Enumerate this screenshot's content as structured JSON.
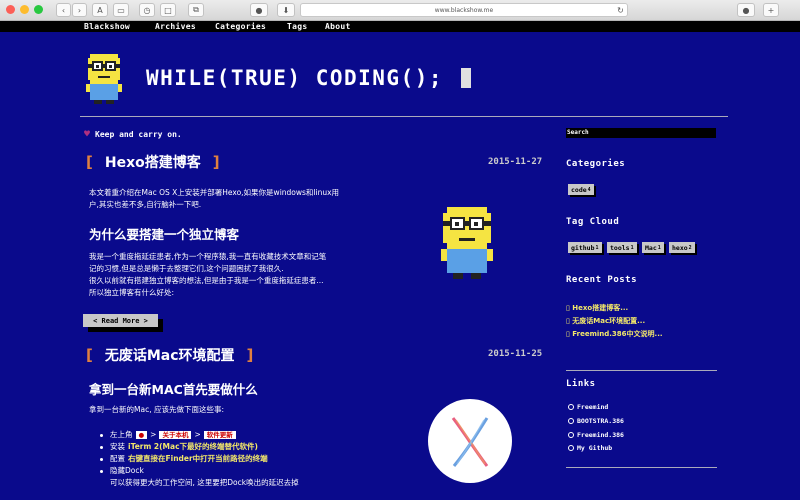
{
  "browser": {
    "url": "www.blackshow.me",
    "colors": {
      "close": "#fc5f57",
      "min": "#fdbc2e",
      "max": "#28c840"
    }
  },
  "nav": {
    "items": [
      {
        "label": "Blackshow"
      },
      {
        "label": "Archives"
      },
      {
        "label": "Categories"
      },
      {
        "label": "Tags"
      },
      {
        "label": "About"
      }
    ]
  },
  "header": {
    "title": "WHILE(TRUE) CODING();",
    "tagline": "Keep and carry on."
  },
  "posts": [
    {
      "title": "Hexo搭建博客",
      "date": "2015-11-27",
      "intro_line1": "本文着重介绍在Mac OS X上安装并部署Hexo,如果你是windows和linux用",
      "intro_line2": "户,其实也差不多,自行脑补一下吧.",
      "subheading": "为什么要搭建一个独立博客",
      "body_line1": "我是一个重度拖延症患者,作为一个程序猿,我一直有收藏技术文章和记笔",
      "body_line2": "记的习惯,但是总是懒于去整理它们,这个问题困扰了我很久.",
      "body_line3": "很久以前就有搭建独立博客的想法,但是由于我是一个重度拖延症患者...",
      "body_line4": "所以独立博客有什么好处:",
      "read_more": "< Read More >"
    },
    {
      "title": "无废话Mac环境配置",
      "date": "2015-11-25",
      "subheading": "拿到一台新MAC首先要做什么",
      "intro": "拿到一台新的Mac, 应该先做下面这些事:",
      "bullet1_pre": "左上角",
      "bullet1_key1": "",
      "bullet1_key2": "关于本机",
      "bullet1_key3": "软件更新",
      "bullet2_pre": "安装",
      "bullet2_hl": "iTerm 2(Mac下最好的终端替代软件)",
      "bullet3_pre": "配置",
      "bullet3_hl": "右键直接在Finder中打开当前路径的终端",
      "bullet4": "隐藏Dock",
      "bullet4_sub": "可以获得更大的工作空间, 这里要把Dock唤出的延迟去掉"
    }
  ],
  "sidebar": {
    "search_placeholder": "Search",
    "categories_heading": "Categories",
    "categories": [
      {
        "name": "code",
        "count": "4"
      }
    ],
    "tagcloud_heading": "Tag Cloud",
    "tags": [
      {
        "name": "github",
        "count": "1"
      },
      {
        "name": "tools",
        "count": "1"
      },
      {
        "name": "Mac",
        "count": "1"
      },
      {
        "name": "hexo",
        "count": "2"
      }
    ],
    "recent_heading": "Recent Posts",
    "recent": [
      {
        "title": "Hexo搭建博客..."
      },
      {
        "title": "无废话Mac环境配置..."
      },
      {
        "title": "Freemind.386中文说明..."
      }
    ],
    "links_heading": "Links",
    "links": [
      {
        "label": "Freemind"
      },
      {
        "label": "BOOTSTRA.386"
      },
      {
        "label": "Freemind.386"
      },
      {
        "label": "My Github"
      }
    ]
  },
  "colors": {
    "background": "#0a0a8c",
    "accent_bracket": "#e08040",
    "highlight": "#f3e86a"
  }
}
